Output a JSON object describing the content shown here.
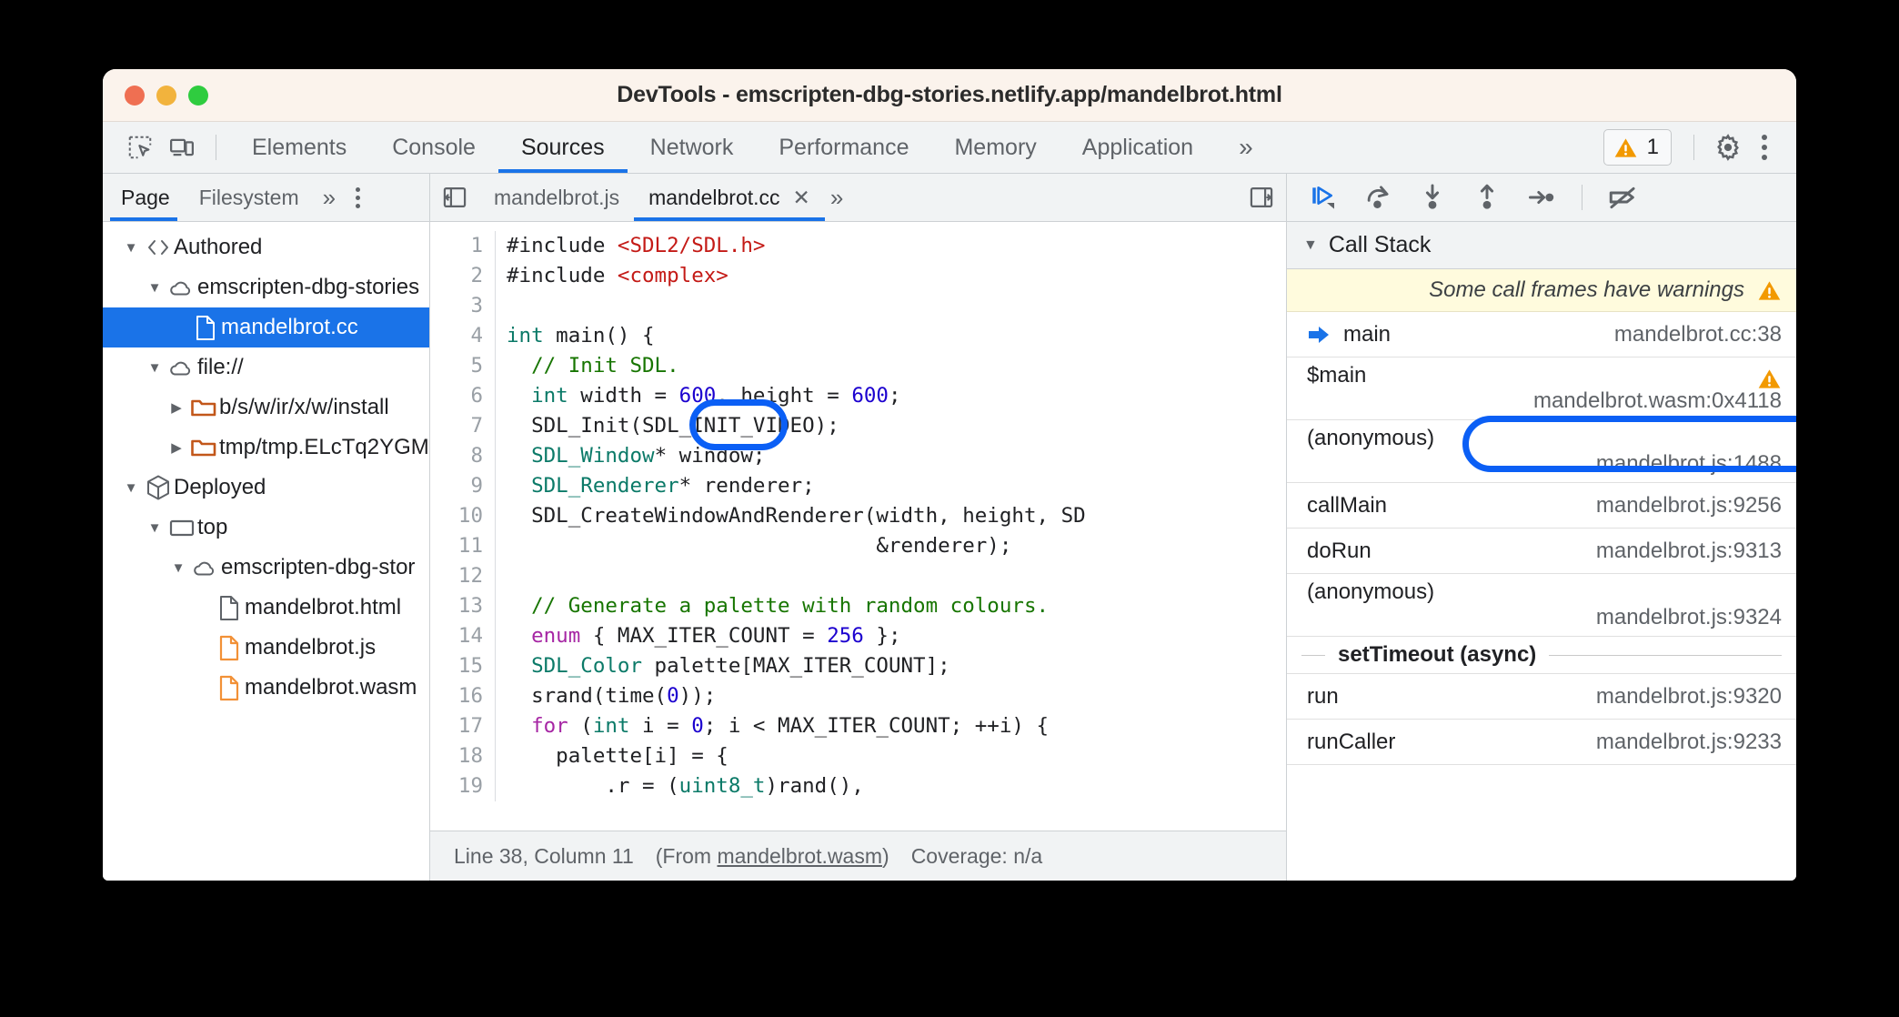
{
  "window": {
    "title": "DevTools - emscripten-dbg-stories.netlify.app/mandelbrot.html",
    "traffic_lights": [
      "close",
      "minimize",
      "zoom"
    ]
  },
  "main_toolbar": {
    "icons": [
      "inspect-element-icon",
      "device-toolbar-icon"
    ],
    "tabs": [
      {
        "label": "Elements",
        "active": false
      },
      {
        "label": "Console",
        "active": false
      },
      {
        "label": "Sources",
        "active": true
      },
      {
        "label": "Network",
        "active": false
      },
      {
        "label": "Performance",
        "active": false
      },
      {
        "label": "Memory",
        "active": false
      },
      {
        "label": "Application",
        "active": false
      }
    ],
    "overflow_label": "»",
    "warning_count": "1",
    "settings_icon": "gear-icon",
    "more_icon": "kebab-icon"
  },
  "navigator": {
    "tabs": [
      {
        "label": "Page",
        "active": true
      },
      {
        "label": "Filesystem",
        "active": false
      }
    ],
    "overflow_label": "»",
    "more_icon": "kebab-icon",
    "tree": [
      {
        "label": "Authored",
        "icon": "code-brackets-icon",
        "indent": 0,
        "twist": "open",
        "selected": false
      },
      {
        "label": "emscripten-dbg-stories",
        "icon": "cloud-icon",
        "indent": 1,
        "twist": "open",
        "selected": false
      },
      {
        "label": "mandelbrot.cc",
        "icon": "file-icon",
        "indent": 2,
        "twist": "none",
        "selected": true
      },
      {
        "label": "file://",
        "icon": "cloud-icon",
        "indent": 1,
        "twist": "open",
        "selected": false
      },
      {
        "label": "b/s/w/ir/x/w/install",
        "icon": "folder-icon",
        "indent": 2,
        "twist": "closed",
        "selected": false
      },
      {
        "label": "tmp/tmp.ELcTq2YGM",
        "icon": "folder-icon",
        "indent": 2,
        "twist": "closed",
        "selected": false
      },
      {
        "label": "Deployed",
        "icon": "cube-icon",
        "indent": 0,
        "twist": "open",
        "selected": false
      },
      {
        "label": "top",
        "icon": "frame-icon",
        "indent": 1,
        "twist": "open",
        "selected": false
      },
      {
        "label": "emscripten-dbg-stor",
        "icon": "cloud-icon",
        "indent": 2,
        "twist": "open",
        "selected": false
      },
      {
        "label": "mandelbrot.html",
        "icon": "file-icon",
        "indent": 3,
        "twist": "none",
        "selected": false
      },
      {
        "label": "mandelbrot.js",
        "icon": "file-js-icon",
        "indent": 3,
        "twist": "none",
        "selected": false
      },
      {
        "label": "mandelbrot.wasm",
        "icon": "file-js-icon",
        "indent": 3,
        "twist": "none",
        "selected": false
      }
    ]
  },
  "editor": {
    "collapse_left_icon": "panel-collapse-left-icon",
    "collapse_right_icon": "panel-collapse-right-icon",
    "tabs": [
      {
        "label": "mandelbrot.js",
        "active": false,
        "closable": false
      },
      {
        "label": "mandelbrot.cc",
        "active": true,
        "closable": true
      }
    ],
    "tab_close_label": "✕",
    "tab_overflow_label": "»",
    "highlighted_token": "main()",
    "lines": [
      {
        "n": "1",
        "tokens": [
          {
            "t": "#include ",
            "c": "pln"
          },
          {
            "t": "<SDL2/SDL.h>",
            "c": "str"
          }
        ]
      },
      {
        "n": "2",
        "tokens": [
          {
            "t": "#include ",
            "c": "pln"
          },
          {
            "t": "<complex>",
            "c": "str"
          }
        ]
      },
      {
        "n": "3",
        "tokens": []
      },
      {
        "n": "4",
        "tokens": [
          {
            "t": "int",
            "c": "kw"
          },
          {
            "t": " main() {",
            "c": "pln"
          }
        ]
      },
      {
        "n": "5",
        "tokens": [
          {
            "t": "  // Init SDL.",
            "c": "cmt"
          }
        ]
      },
      {
        "n": "6",
        "tokens": [
          {
            "t": "  ",
            "c": "pln"
          },
          {
            "t": "int",
            "c": "kw"
          },
          {
            "t": " width = ",
            "c": "pln"
          },
          {
            "t": "600",
            "c": "num"
          },
          {
            "t": ", height = ",
            "c": "pln"
          },
          {
            "t": "600",
            "c": "num"
          },
          {
            "t": ";",
            "c": "pln"
          }
        ]
      },
      {
        "n": "7",
        "tokens": [
          {
            "t": "  SDL_Init(SDL_INIT_VIDEO);",
            "c": "pln"
          }
        ]
      },
      {
        "n": "8",
        "tokens": [
          {
            "t": "  ",
            "c": "pln"
          },
          {
            "t": "SDL_Window",
            "c": "kw"
          },
          {
            "t": "* window;",
            "c": "pln"
          }
        ]
      },
      {
        "n": "9",
        "tokens": [
          {
            "t": "  ",
            "c": "pln"
          },
          {
            "t": "SDL_Renderer",
            "c": "kw"
          },
          {
            "t": "* renderer;",
            "c": "pln"
          }
        ]
      },
      {
        "n": "10",
        "tokens": [
          {
            "t": "  SDL_CreateWindowAndRenderer(width, height, SD",
            "c": "pln"
          }
        ]
      },
      {
        "n": "11",
        "tokens": [
          {
            "t": "                              &renderer);",
            "c": "pln"
          }
        ]
      },
      {
        "n": "12",
        "tokens": []
      },
      {
        "n": "13",
        "tokens": [
          {
            "t": "  // Generate a palette with random colours.",
            "c": "cmt"
          }
        ]
      },
      {
        "n": "14",
        "tokens": [
          {
            "t": "  ",
            "c": "pln"
          },
          {
            "t": "enum",
            "c": "ctl"
          },
          {
            "t": " { MAX_ITER_COUNT = ",
            "c": "pln"
          },
          {
            "t": "256",
            "c": "num"
          },
          {
            "t": " };",
            "c": "pln"
          }
        ]
      },
      {
        "n": "15",
        "tokens": [
          {
            "t": "  ",
            "c": "pln"
          },
          {
            "t": "SDL_Color",
            "c": "kw"
          },
          {
            "t": " palette[MAX_ITER_COUNT];",
            "c": "pln"
          }
        ]
      },
      {
        "n": "16",
        "tokens": [
          {
            "t": "  srand(time(",
            "c": "pln"
          },
          {
            "t": "0",
            "c": "num"
          },
          {
            "t": "));",
            "c": "pln"
          }
        ]
      },
      {
        "n": "17",
        "tokens": [
          {
            "t": "  ",
            "c": "pln"
          },
          {
            "t": "for",
            "c": "ctl"
          },
          {
            "t": " (",
            "c": "pln"
          },
          {
            "t": "int",
            "c": "kw"
          },
          {
            "t": " i = ",
            "c": "pln"
          },
          {
            "t": "0",
            "c": "num"
          },
          {
            "t": "; i < MAX_ITER_COUNT; ++i) {",
            "c": "pln"
          }
        ]
      },
      {
        "n": "18",
        "tokens": [
          {
            "t": "    palette[i] = {",
            "c": "pln"
          }
        ]
      },
      {
        "n": "19",
        "tokens": [
          {
            "t": "        .r = (",
            "c": "pln"
          },
          {
            "t": "uint8_t",
            "c": "kw"
          },
          {
            "t": ")rand(),",
            "c": "pln"
          }
        ]
      }
    ],
    "status": {
      "position": "Line 38, Column 11",
      "from_prefix": "(From ",
      "from_file": "mandelbrot.wasm",
      "from_suffix": ")",
      "coverage": "Coverage: n/a"
    }
  },
  "debugger": {
    "toolbar": [
      {
        "name": "resume-script-execution-icon",
        "active": true
      },
      {
        "name": "step-over-next-function-call-icon",
        "active": false
      },
      {
        "name": "step-into-next-function-call-icon",
        "active": false
      },
      {
        "name": "step-out-of-current-function-icon",
        "active": false
      },
      {
        "name": "step-icon",
        "active": false
      },
      {
        "name": "deactivate-breakpoints-icon",
        "active": false
      }
    ],
    "call_stack": {
      "title": "Call Stack",
      "caret": "open",
      "warning_banner": "Some call frames have warnings",
      "frames": [
        {
          "name": "main",
          "location": "mandelbrot.cc:38",
          "current": true,
          "wrap": false,
          "warning": false,
          "highlighted": true
        },
        {
          "name": "$main",
          "location": "mandelbrot.wasm:0x4118",
          "current": false,
          "wrap": true,
          "warning": true,
          "highlighted": false
        },
        {
          "name": "(anonymous)",
          "location": "mandelbrot.js:1488",
          "current": false,
          "wrap": true,
          "warning": false,
          "highlighted": false
        },
        {
          "name": "callMain",
          "location": "mandelbrot.js:9256",
          "current": false,
          "wrap": false,
          "warning": false,
          "highlighted": false
        },
        {
          "name": "doRun",
          "location": "mandelbrot.js:9313",
          "current": false,
          "wrap": false,
          "warning": false,
          "highlighted": false
        },
        {
          "name": "(anonymous)",
          "location": "mandelbrot.js:9324",
          "current": false,
          "wrap": true,
          "warning": false,
          "highlighted": false
        }
      ],
      "async_separator": "setTimeout (async)",
      "frames_after_async": [
        {
          "name": "run",
          "location": "mandelbrot.js:9320",
          "current": false,
          "wrap": false,
          "warning": false,
          "highlighted": false
        },
        {
          "name": "runCaller",
          "location": "mandelbrot.js:9233",
          "current": false,
          "wrap": false,
          "warning": false,
          "highlighted": false
        }
      ]
    }
  },
  "colors": {
    "accent_blue": "#1a73e8",
    "highlight_ring": "#0b5ff5",
    "warning_orange": "#f29900",
    "selection_blue": "#1a73e8",
    "titlebar_bg": "#fbf3ec",
    "toolbar_bg": "#f1f3f4",
    "warning_banner_bg": "#fffbdd"
  }
}
